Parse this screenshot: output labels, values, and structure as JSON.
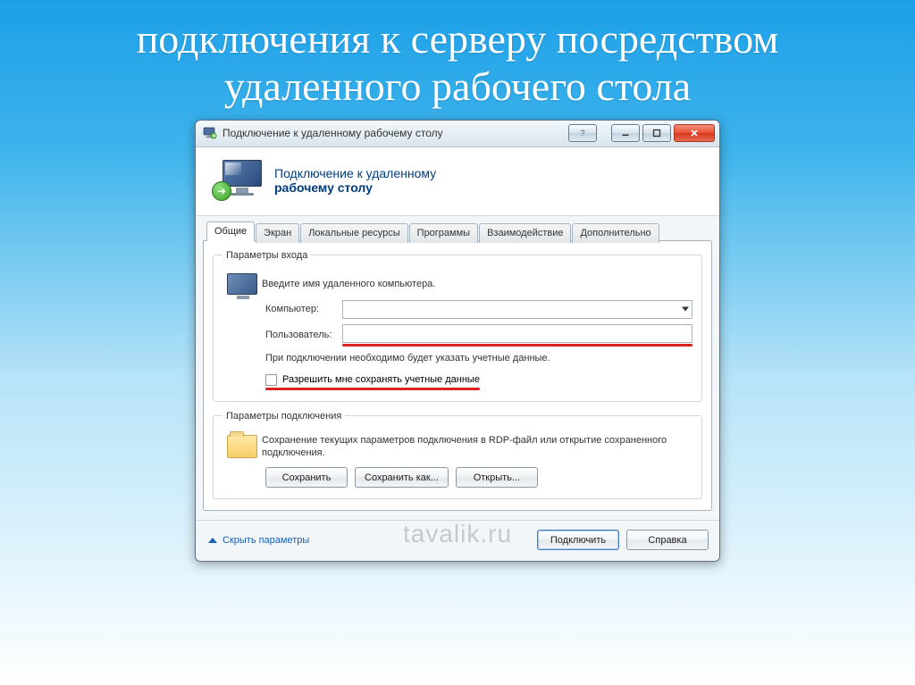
{
  "slide": {
    "title": "подключения к серверу посредством удаленного рабочего стола"
  },
  "window": {
    "title": "Подключение к удаленному рабочему столу",
    "header_line1": "Подключение к удаленному",
    "header_line2": "рабочему столу",
    "tabs": [
      {
        "label": "Общие",
        "active": true
      },
      {
        "label": "Экран",
        "active": false
      },
      {
        "label": "Локальные ресурсы",
        "active": false
      },
      {
        "label": "Программы",
        "active": false
      },
      {
        "label": "Взаимодействие",
        "active": false
      },
      {
        "label": "Дополнительно",
        "active": false
      }
    ],
    "login_group": {
      "legend": "Параметры входа",
      "prompt": "Введите имя удаленного компьютера.",
      "computer_label": "Компьютер:",
      "computer_value": "",
      "user_label": "Пользователь:",
      "user_value": "",
      "note": "При подключении необходимо будет указать учетные данные.",
      "save_creds_label": "Разрешить мне сохранять учетные данные"
    },
    "conn_group": {
      "legend": "Параметры подключения",
      "note": "Сохранение текущих параметров подключения в RDP-файл или открытие сохраненного подключения.",
      "save": "Сохранить",
      "save_as": "Сохранить как...",
      "open": "Открыть..."
    },
    "footer": {
      "hide_params": "Скрыть параметры",
      "connect": "Подключить",
      "help": "Справка"
    }
  },
  "watermark": "tavalik.ru"
}
